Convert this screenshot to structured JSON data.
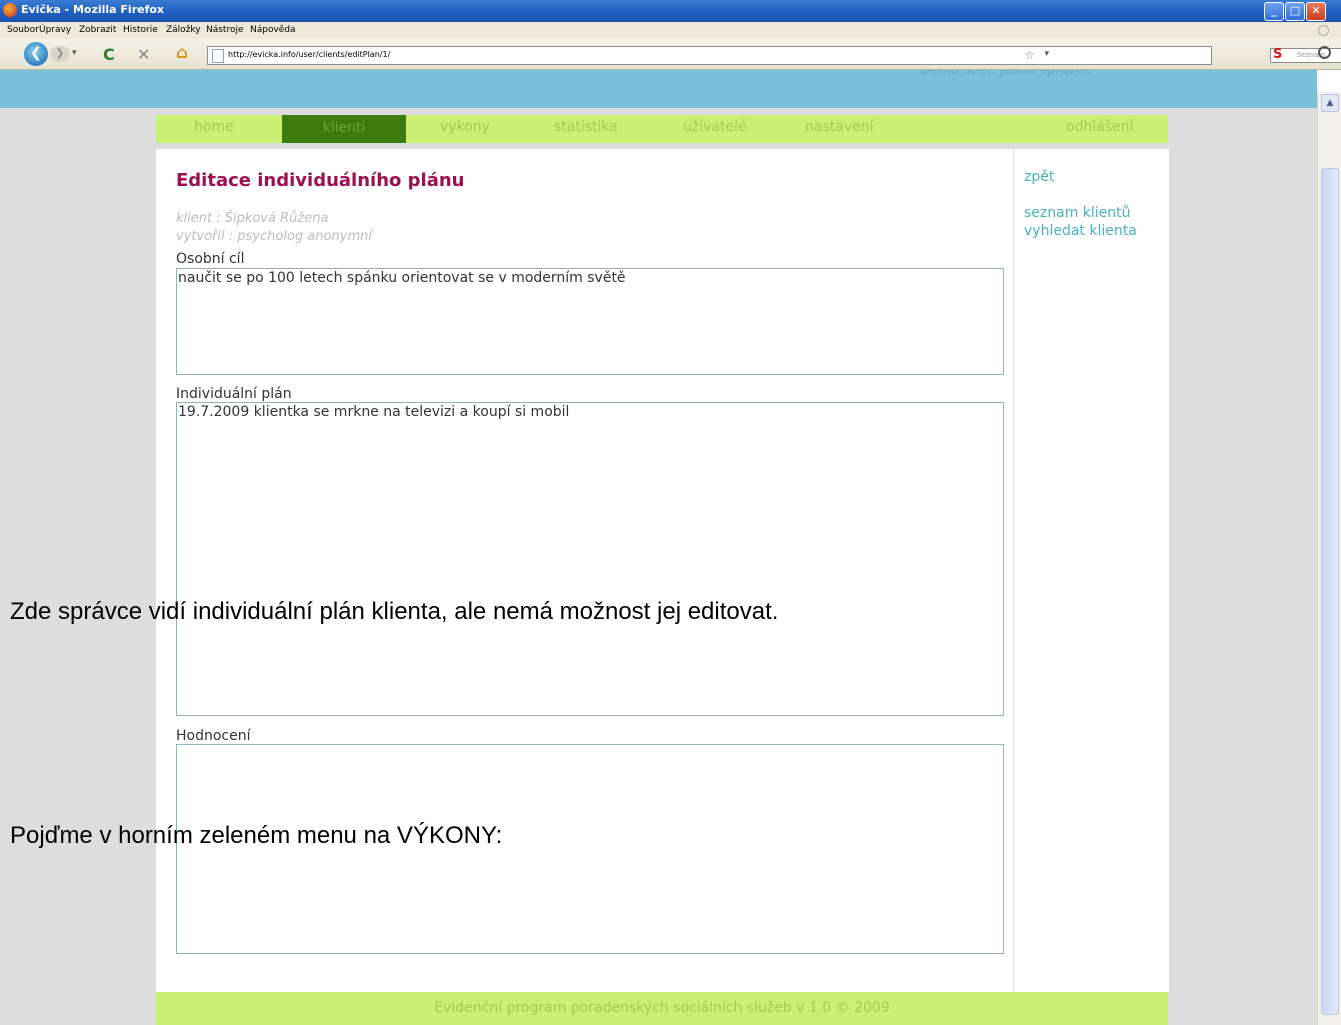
{
  "window": {
    "title": "Evička - Mozilla Firefox",
    "buttons": {
      "minimize": "_",
      "maximize": "□",
      "close": "✕"
    }
  },
  "menubar": [
    "Soubor",
    "Úpravy",
    "Zobrazit",
    "Historie",
    "Záložky",
    "Nástroje",
    "Nápověda"
  ],
  "toolbar": {
    "url": "http://evicka.info/user/clients/editPlan/1/",
    "search_placeholder": "Seznam",
    "search_engine_letter": "S",
    "back_glyph": "❮",
    "forward_glyph": "❯",
    "reload_glyph": "C",
    "stop_glyph": "✕",
    "home_glyph": "⌂",
    "star_glyph": "☆",
    "drop_glyph": "▾"
  },
  "page": {
    "top_text": "Demo účet, jedná správce",
    "nav": [
      "home",
      "klienti",
      "vykony",
      "statistika",
      "uživatelé",
      "nastavení",
      "odhlášení"
    ],
    "active_nav": "klienti",
    "heading": "Editace individuálního plánu",
    "meta_client": "klient : Šipková Růžena",
    "meta_author": "vytvořil : psycholog anonymní",
    "fields": {
      "goal_label": "Osobní cíl",
      "goal_value": "naučit se po 100 letech spánku orientovat se v moderním světě",
      "plan_label": "Individuální plán",
      "plan_value": "19.7.2009  klientka se mrkne na televizi a koupí si mobil",
      "eval_label": "Hodnocení",
      "eval_value": ""
    },
    "sidebar": {
      "back": "zpět",
      "list": "seznam klientů",
      "search": "vyhledat klienta"
    },
    "footer": "Evidenční program poradenských sociálních služeb v 1.0 © 2009"
  },
  "overlay": {
    "line1": "Zde správce vidí individuální plán klienta, ale nemá možnost jej editovat.",
    "line2": "Pojďme  v horním zeleném menu  na VÝKONY:"
  }
}
